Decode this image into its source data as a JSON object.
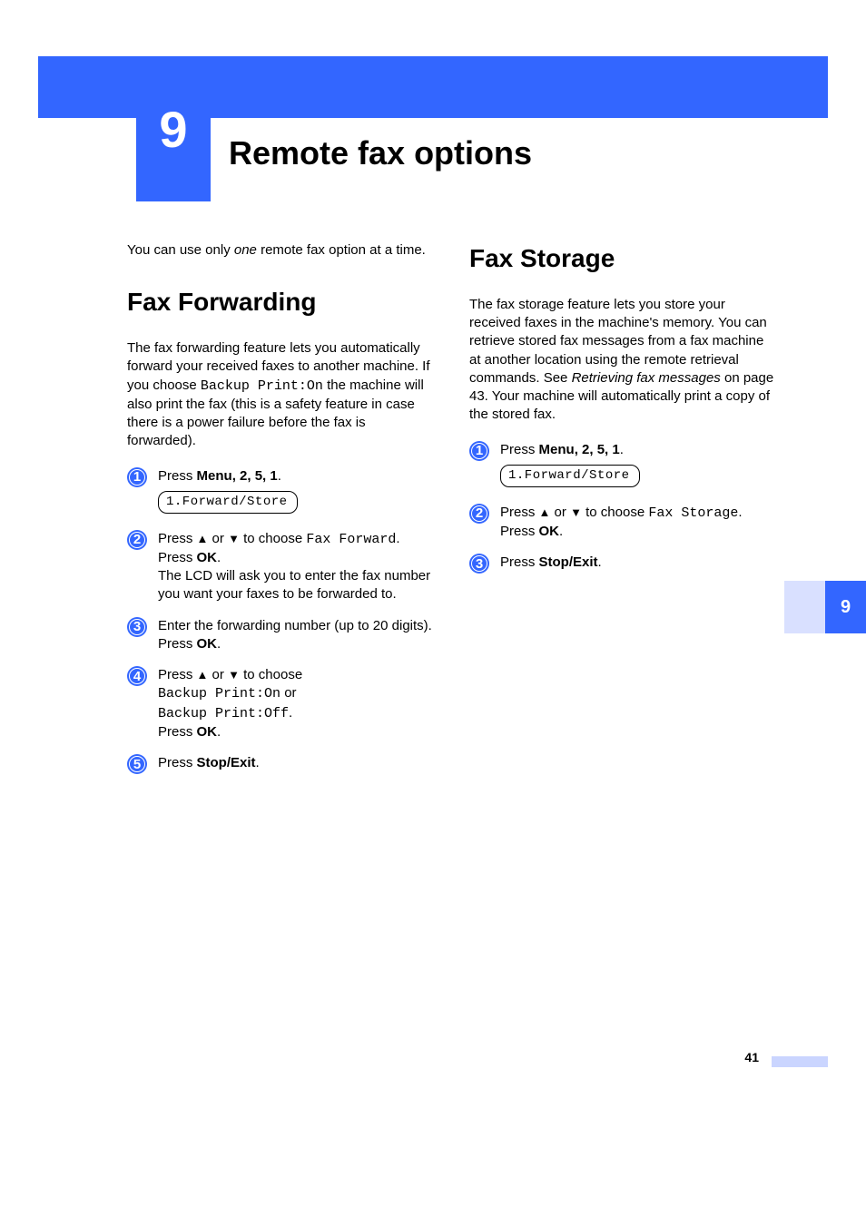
{
  "chapter": {
    "number": "9",
    "title": "Remote fax options"
  },
  "sideTab": "9",
  "pageNumber": "41",
  "left": {
    "intro_prefix": "You can use only ",
    "intro_italic": "one",
    "intro_suffix": " remote fax option at a time.",
    "h2": "Fax Forwarding",
    "body_prefix": "The fax forwarding feature lets you automatically forward your received faxes to another machine. If you choose ",
    "body_mono": "Backup Print:On",
    "body_suffix": " the machine will also print the fax (this is a safety feature in case there is a power failure before the fax is forwarded).",
    "step1_prefix": "Press ",
    "step1_menu": "Menu",
    "step1_keys": ", 2, 5, 1",
    "step1_dot": ".",
    "step1_lcd": "1.Forward/Store",
    "step2_prefix": "Press ",
    "step2_or": " or ",
    "step2_choose": " to choose ",
    "step2_mono": "Fax Forward",
    "step2_dot": ".",
    "step2_press": "Press ",
    "step2_ok": "OK",
    "step2_dot2": ".",
    "step2_tail": "The LCD will ask you to enter the fax number you want your faxes to be forwarded to.",
    "step3_line1": "Enter the forwarding number (up to 20 digits).",
    "step3_press": "Press ",
    "step3_ok": "OK",
    "step3_dot": ".",
    "step4_prefix": "Press ",
    "step4_or": " or ",
    "step4_choose": " to choose ",
    "step4_mono1": "Backup Print:On",
    "step4_or2": " or ",
    "step4_mono2": "Backup Print:Off",
    "step4_dot": ".",
    "step4_press": "Press ",
    "step4_ok": "OK",
    "step4_dot2": ".",
    "step5_prefix": "Press ",
    "step5_stop": "Stop/Exit",
    "step5_dot": "."
  },
  "right": {
    "h2": "Fax Storage",
    "body_prefix": "The fax storage feature lets you store your received faxes in the machine's memory. You can retrieve stored fax messages from a fax machine at another location using the remote retrieval commands. See ",
    "body_italic": "Retrieving fax messages",
    "body_suffix": " on page 43. Your machine will automatically print a copy of the stored fax.",
    "step1_prefix": "Press ",
    "step1_menu": "Menu",
    "step1_keys": ", 2, 5, 1",
    "step1_dot": ".",
    "step1_lcd": "1.Forward/Store",
    "step2_prefix": "Press ",
    "step2_or": " or ",
    "step2_choose": " to choose ",
    "step2_mono": "Fax Storage",
    "step2_dot": ".",
    "step2_press": "Press ",
    "step2_ok": "OK",
    "step2_dot2": ".",
    "step3_prefix": "Press ",
    "step3_stop": "Stop/Exit",
    "step3_dot": "."
  }
}
